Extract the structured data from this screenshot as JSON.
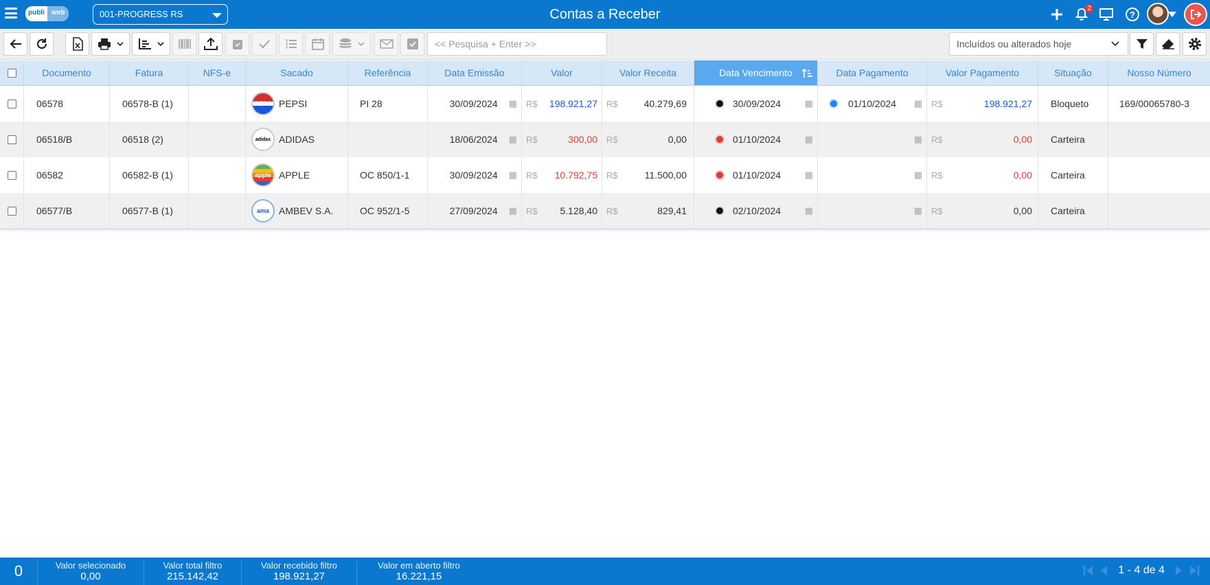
{
  "header": {
    "logo_part1": "publi",
    "logo_part2": "web",
    "company": "001-PROGRESS RS",
    "title": "Contas a Receber",
    "notification_count": "2"
  },
  "toolbar": {
    "search_placeholder": "<< Pesquisa + Enter >>",
    "filter_value": "Incluídos ou alterados hoje"
  },
  "columns": [
    "Documento",
    "Fatura",
    "NFS-e",
    "Sacado",
    "Referência",
    "Data Emissão",
    "Valor",
    "Valor Receita",
    "Data Vencimento",
    "Data Pagamento",
    "Valor Pagamento",
    "Situação",
    "Nosso Número"
  ],
  "currency": "R$",
  "rows": [
    {
      "documento": "06578",
      "fatura": "06578-B (1)",
      "nfse": "",
      "sacado": "PEPSI",
      "logo": "PEPS",
      "referencia": "PI 28",
      "emissao": "30/09/2024",
      "valor": "198.921,27",
      "valor_color": "blue",
      "receita": "40.279,69",
      "venc_dot": "black",
      "vencimento": "30/09/2024",
      "pag_dot": "blue",
      "pagamento": "01/10/2024",
      "valor_pag": "198.921,27",
      "valor_pag_color": "blue",
      "situacao": "Bloqueto",
      "nosso_numero": "169/00065780-3"
    },
    {
      "documento": "06518/B",
      "fatura": "06518 (2)",
      "nfse": "",
      "sacado": "ADIDAS",
      "logo": "adidas",
      "referencia": "",
      "emissao": "18/06/2024",
      "valor": "300,00",
      "valor_color": "red",
      "receita": "0,00",
      "venc_dot": "red",
      "vencimento": "01/10/2024",
      "pag_dot": "",
      "pagamento": "",
      "valor_pag": "0,00",
      "valor_pag_color": "red",
      "situacao": "Carteira",
      "nosso_numero": ""
    },
    {
      "documento": "06582",
      "fatura": "06582-B (1)",
      "nfse": "",
      "sacado": "APPLE",
      "logo": "apple",
      "referencia": "OC 850/1-1",
      "emissao": "30/09/2024",
      "valor": "10.792,75",
      "valor_color": "red",
      "receita": "11.500,00",
      "venc_dot": "red",
      "vencimento": "01/10/2024",
      "pag_dot": "",
      "pagamento": "",
      "valor_pag": "0,00",
      "valor_pag_color": "red",
      "situacao": "Carteira",
      "nosso_numero": ""
    },
    {
      "documento": "06577/B",
      "fatura": "06577-B (1)",
      "nfse": "",
      "sacado": "AMBEV S.A.",
      "logo": "ama",
      "referencia": "OC 952/1-5",
      "emissao": "27/09/2024",
      "valor": "5.128,40",
      "valor_color": "default",
      "receita": "829,41",
      "venc_dot": "black",
      "vencimento": "02/10/2024",
      "pag_dot": "",
      "pagamento": "",
      "valor_pag": "0,00",
      "valor_pag_color": "default",
      "situacao": "Carteira",
      "nosso_numero": ""
    }
  ],
  "footer": {
    "selected_count": "0",
    "stats": [
      {
        "label": "Valor selecionado",
        "value": "0,00"
      },
      {
        "label": "Valor total filtro",
        "value": "215.142,42"
      },
      {
        "label": "Valor recebido filtro",
        "value": "198.921,27"
      },
      {
        "label": "Valor em aberto filtro",
        "value": "16.221,15"
      }
    ],
    "pagination": "1 - 4 de 4"
  }
}
